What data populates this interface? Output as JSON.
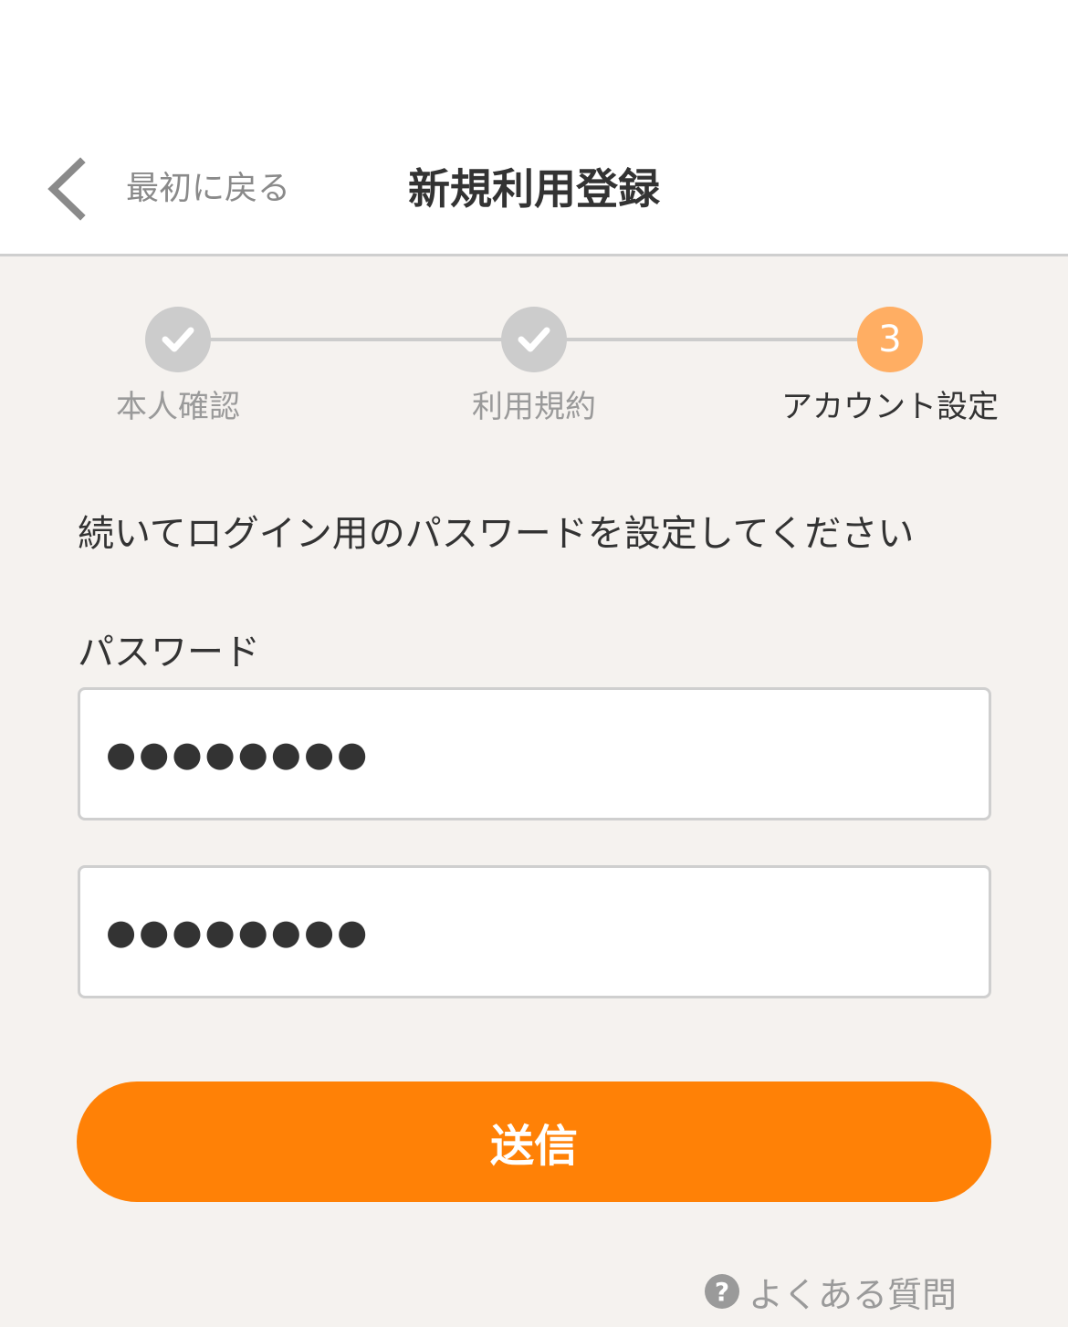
{
  "header": {
    "back_label": "最初に戻る",
    "title": "新規利用登録"
  },
  "steps": [
    {
      "label": "本人確認",
      "status": "done"
    },
    {
      "label": "利用規約",
      "status": "done"
    },
    {
      "label": "アカウント設定",
      "status": "current",
      "number": "3"
    }
  ],
  "form": {
    "instruction": "続いてログイン用のパスワードを設定してください",
    "password_label": "パスワード",
    "password_value": "●●●●●●●●",
    "password_confirm_value": "●●●●●●●●",
    "submit_label": "送信"
  },
  "faq": {
    "icon": "question-circle-icon",
    "label": "よくある質問"
  },
  "colors": {
    "accent": "#ff8106",
    "step_active": "#ffae63",
    "step_done": "#cccccc",
    "background": "#f5f2ef"
  }
}
